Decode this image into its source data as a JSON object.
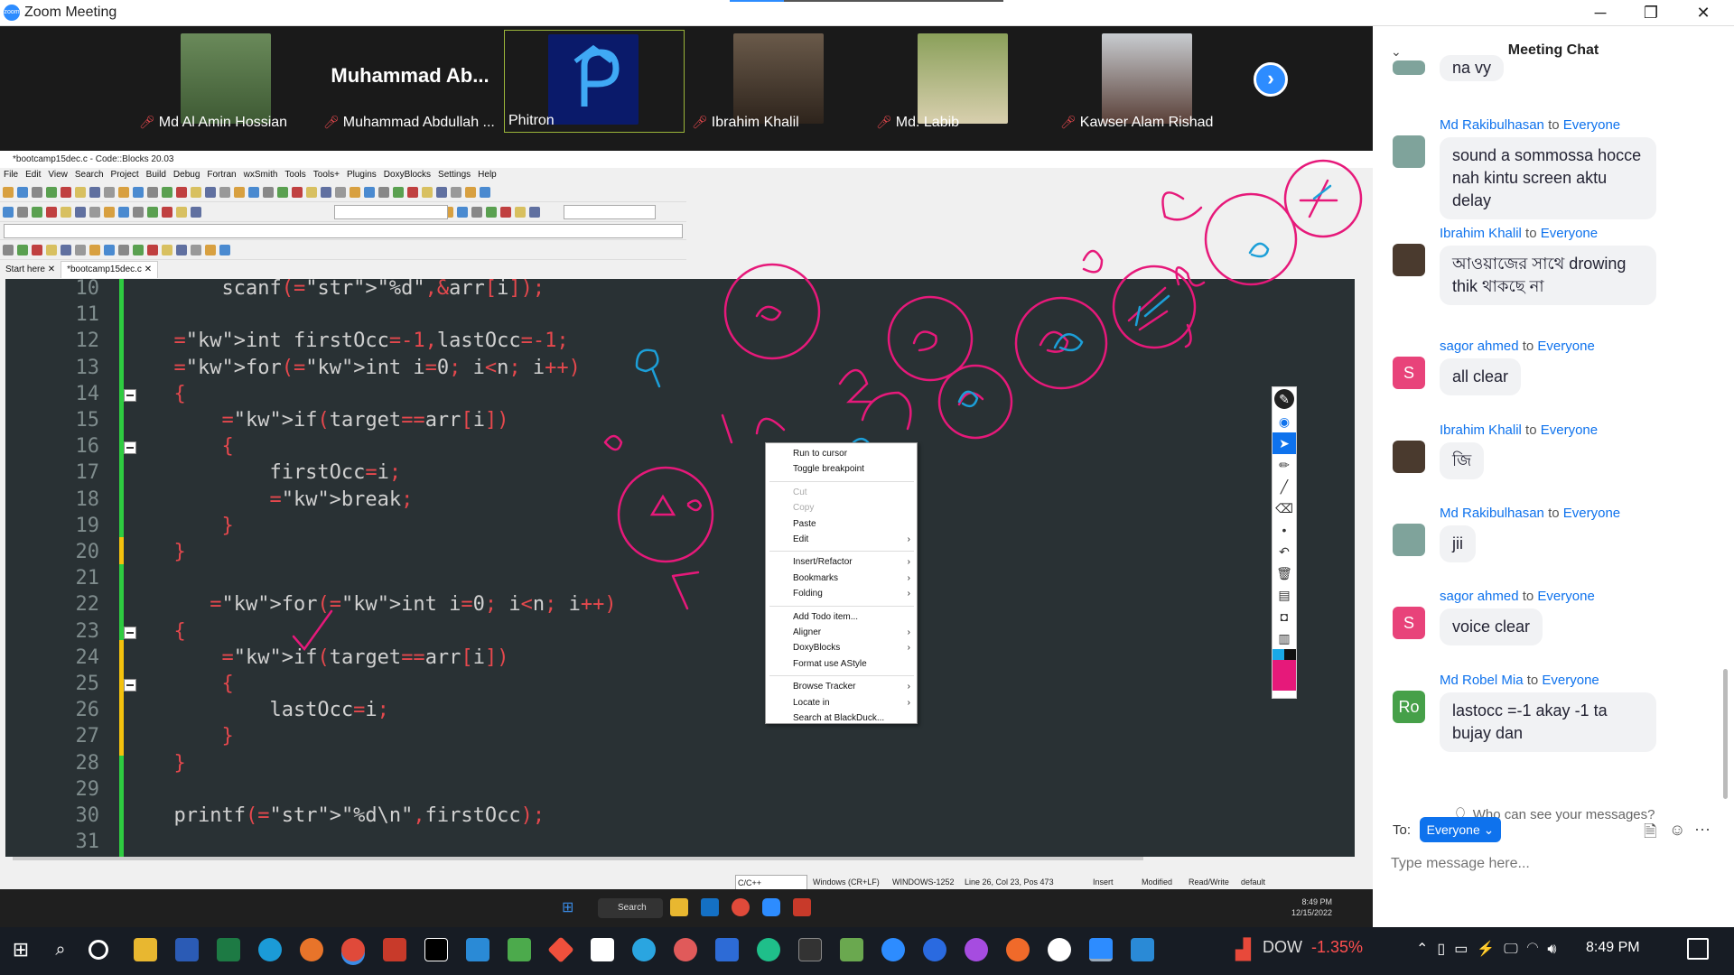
{
  "window": {
    "title": "Zoom Meeting",
    "controls": {
      "minimize": "─",
      "restore": "❐",
      "close": "✕"
    }
  },
  "gallery": {
    "participants": [
      {
        "name": "Md Al Amin Hossian",
        "muted": true,
        "photo_color": "#5b7a4a"
      },
      {
        "name": "Muhammad Abdullah ...",
        "display_name": "Muhammad  Ab...",
        "muted": true
      },
      {
        "name": "Phitron",
        "muted": false,
        "active": true,
        "photo_color": "#0a1a6a"
      },
      {
        "name": "Ibrahim Khalil",
        "muted": true,
        "photo_color": "#5a4a3a"
      },
      {
        "name": "Md. Labib",
        "muted": true,
        "photo_color": "#7a8a4a"
      },
      {
        "name": "Kawser Alam Rishad",
        "muted": true,
        "photo_color": "#8a8e92"
      }
    ],
    "next_label": "›"
  },
  "codeblocks": {
    "title": "*bootcamp15dec.c - Code::Blocks 20.03",
    "menu": [
      "File",
      "Edit",
      "View",
      "Search",
      "Project",
      "Build",
      "Debug",
      "Fortran",
      "wxSmith",
      "Tools",
      "Tools+",
      "Plugins",
      "DoxyBlocks",
      "Settings",
      "Help"
    ],
    "tabs": [
      {
        "label": "Start here ✕"
      },
      {
        "label": "*bootcamp15dec.c ✕"
      }
    ],
    "lines": [
      {
        "n": "10",
        "code": "      scanf(\"%d\",&arr[i]);"
      },
      {
        "n": "11",
        "code": ""
      },
      {
        "n": "12",
        "code": "  int firstOcc=-1,lastOcc=-1;"
      },
      {
        "n": "13",
        "code": "  for(int i=0; i<n; i++)"
      },
      {
        "n": "14",
        "code": "  {"
      },
      {
        "n": "15",
        "code": "      if(target==arr[i])"
      },
      {
        "n": "16",
        "code": "      {"
      },
      {
        "n": "17",
        "code": "          firstOcc=i;"
      },
      {
        "n": "18",
        "code": "          break;"
      },
      {
        "n": "19",
        "code": "      }"
      },
      {
        "n": "20",
        "code": "  }"
      },
      {
        "n": "21",
        "code": ""
      },
      {
        "n": "22",
        "code": "     for(int i=0; i<n; i++)"
      },
      {
        "n": "23",
        "code": "  {"
      },
      {
        "n": "24",
        "code": "      if(target==arr[i])"
      },
      {
        "n": "25",
        "code": "      {"
      },
      {
        "n": "26",
        "code": "          lastOcc=i;"
      },
      {
        "n": "27",
        "code": "      }"
      },
      {
        "n": "28",
        "code": "  }"
      },
      {
        "n": "29",
        "code": ""
      },
      {
        "n": "30",
        "code": "  printf(\"%d\\n\",firstOcc);"
      },
      {
        "n": "31",
        "code": ""
      }
    ],
    "status": {
      "lang": "C/C++",
      "eol": "Windows (CR+LF)",
      "enc": "WINDOWS-1252",
      "pos": "Line 26, Col 23, Pos 473",
      "mode": "Insert",
      "mod": "Modified",
      "rw": "Read/Write",
      "profile": "default"
    }
  },
  "context_menu": [
    {
      "label": "Run to cursor"
    },
    {
      "label": "Toggle breakpoint"
    },
    {
      "sep": true
    },
    {
      "label": "Cut",
      "disabled": true
    },
    {
      "label": "Copy",
      "disabled": true
    },
    {
      "label": "Paste"
    },
    {
      "label": "Edit",
      "sub": true
    },
    {
      "sep": true
    },
    {
      "label": "Insert/Refactor",
      "sub": true
    },
    {
      "label": "Bookmarks",
      "sub": true
    },
    {
      "label": "Folding",
      "sub": true
    },
    {
      "sep": true
    },
    {
      "label": "Add Todo item..."
    },
    {
      "label": "Aligner",
      "sub": true
    },
    {
      "label": "DoxyBlocks",
      "sub": true
    },
    {
      "label": "Format use AStyle"
    },
    {
      "sep": true
    },
    {
      "label": "Browse Tracker",
      "sub": true
    },
    {
      "label": "Locate in",
      "sub": true
    },
    {
      "label": "Search at BlackDuck..."
    }
  ],
  "inner_taskbar": {
    "search": "Search",
    "time": "8:49 PM",
    "date": "12/15/2022"
  },
  "chat": {
    "title": "Meeting Chat",
    "partial_top": "na vy",
    "messages": [
      {
        "author": "Md Rakibulhasan",
        "to": "to",
        "target": "Everyone",
        "text": "sound a sommossa hocce nah kintu screen aktu delay",
        "avatar": "",
        "avatar_color": "#7fa39b"
      },
      {
        "author": "Ibrahim Khalil",
        "to": "to",
        "target": "Everyone",
        "text": "আওয়াজের সাথে drowing thik থাকছে না",
        "avatar": "",
        "avatar_color": "#4a3a2e"
      },
      {
        "author": "sagor ahmed",
        "to": "to",
        "target": "Everyone",
        "text": "all clear",
        "avatar": "S",
        "avatar_color": "#e8437a"
      },
      {
        "author": "Ibrahim Khalil",
        "to": "to",
        "target": "Everyone",
        "text": "জি",
        "avatar": "",
        "avatar_color": "#4a3a2e"
      },
      {
        "author": "Md Rakibulhasan",
        "to": "to",
        "target": "Everyone",
        "text": "jii",
        "avatar": "",
        "avatar_color": "#7fa39b"
      },
      {
        "author": "sagor ahmed",
        "to": "to",
        "target": "Everyone",
        "text": "voice clear",
        "avatar": "S",
        "avatar_color": "#e8437a"
      },
      {
        "author": "Md Robel Mia",
        "to": "to",
        "target": "Everyone",
        "text": "lastocc =-1 akay -1 ta bujay dan",
        "avatar": "Ro",
        "avatar_color": "#46a049"
      }
    ],
    "who_can_see": "Who can see your messages?",
    "to_label": "To:",
    "to_value": "Everyone ⌄",
    "placeholder": "Type message here..."
  },
  "win_taskbar": {
    "stock": "DOW",
    "stock_change": "-1.35%",
    "time": "8:49 PM"
  },
  "colors": {
    "pen": "#e6197a",
    "blue_pen": "#1c9fd8",
    "zoom_blue": "#0e72ed"
  }
}
